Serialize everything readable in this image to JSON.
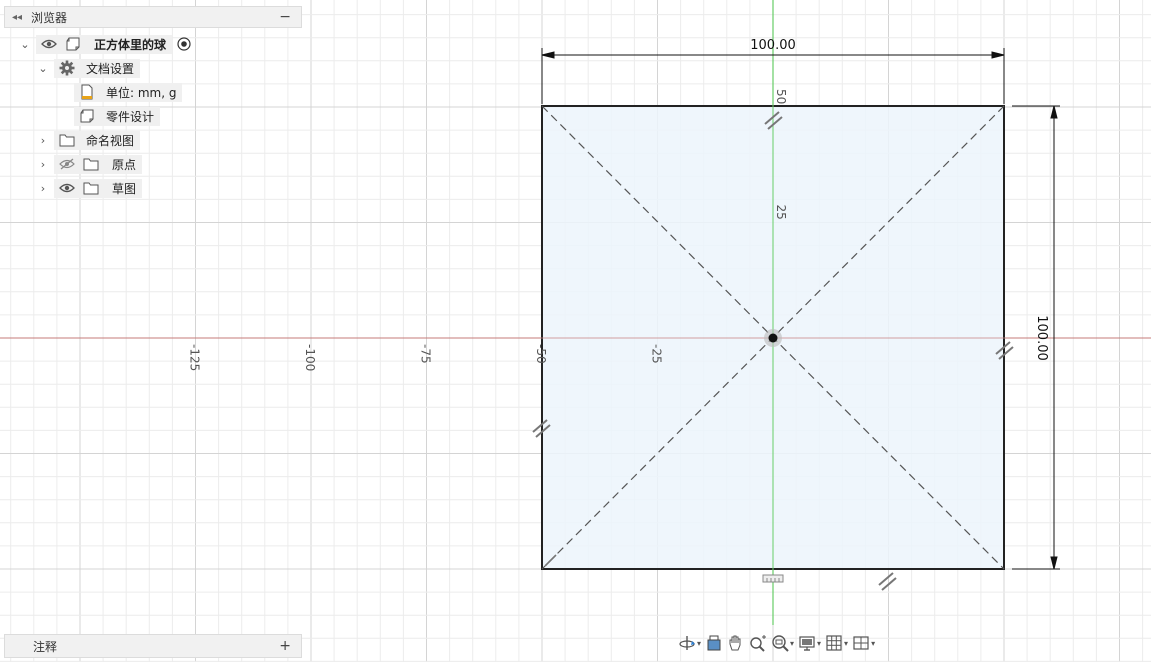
{
  "browser": {
    "title": "浏览器",
    "root": {
      "label": "正方体里的球"
    },
    "items": [
      {
        "label": "文档设置",
        "icon": "gear-icon"
      },
      {
        "label": "单位: mm, g",
        "icon": "units-document-icon"
      },
      {
        "label": "零件设计",
        "icon": "component-icon"
      },
      {
        "label": "命名视图",
        "icon": "folder-icon"
      },
      {
        "label": "原点",
        "icon": "folder-icon",
        "visibility": "hidden"
      },
      {
        "label": "草图",
        "icon": "folder-icon",
        "visibility": "visible"
      }
    ]
  },
  "annotations": {
    "label": "注释"
  },
  "viewport": {
    "x_axis_labels": [
      "-125",
      "-100",
      "-75",
      "-50",
      "-25"
    ],
    "y_axis_labels": [
      "50",
      "25"
    ],
    "dimension_width": "100.00",
    "dimension_height": "100.00"
  },
  "colors": {
    "sketch_fill": "#ecf5fc",
    "x_axis": "#c0504d",
    "y_axis": "#4cc24c",
    "grid": "#e2e2e2",
    "sketch_line": "#222222"
  },
  "toolbar": {
    "items": [
      "orbit-icon",
      "look-at-icon",
      "pan-icon",
      "zoom-icon",
      "fit-icon",
      "display-settings-icon",
      "grid-snap-icon",
      "viewports-icon"
    ]
  }
}
